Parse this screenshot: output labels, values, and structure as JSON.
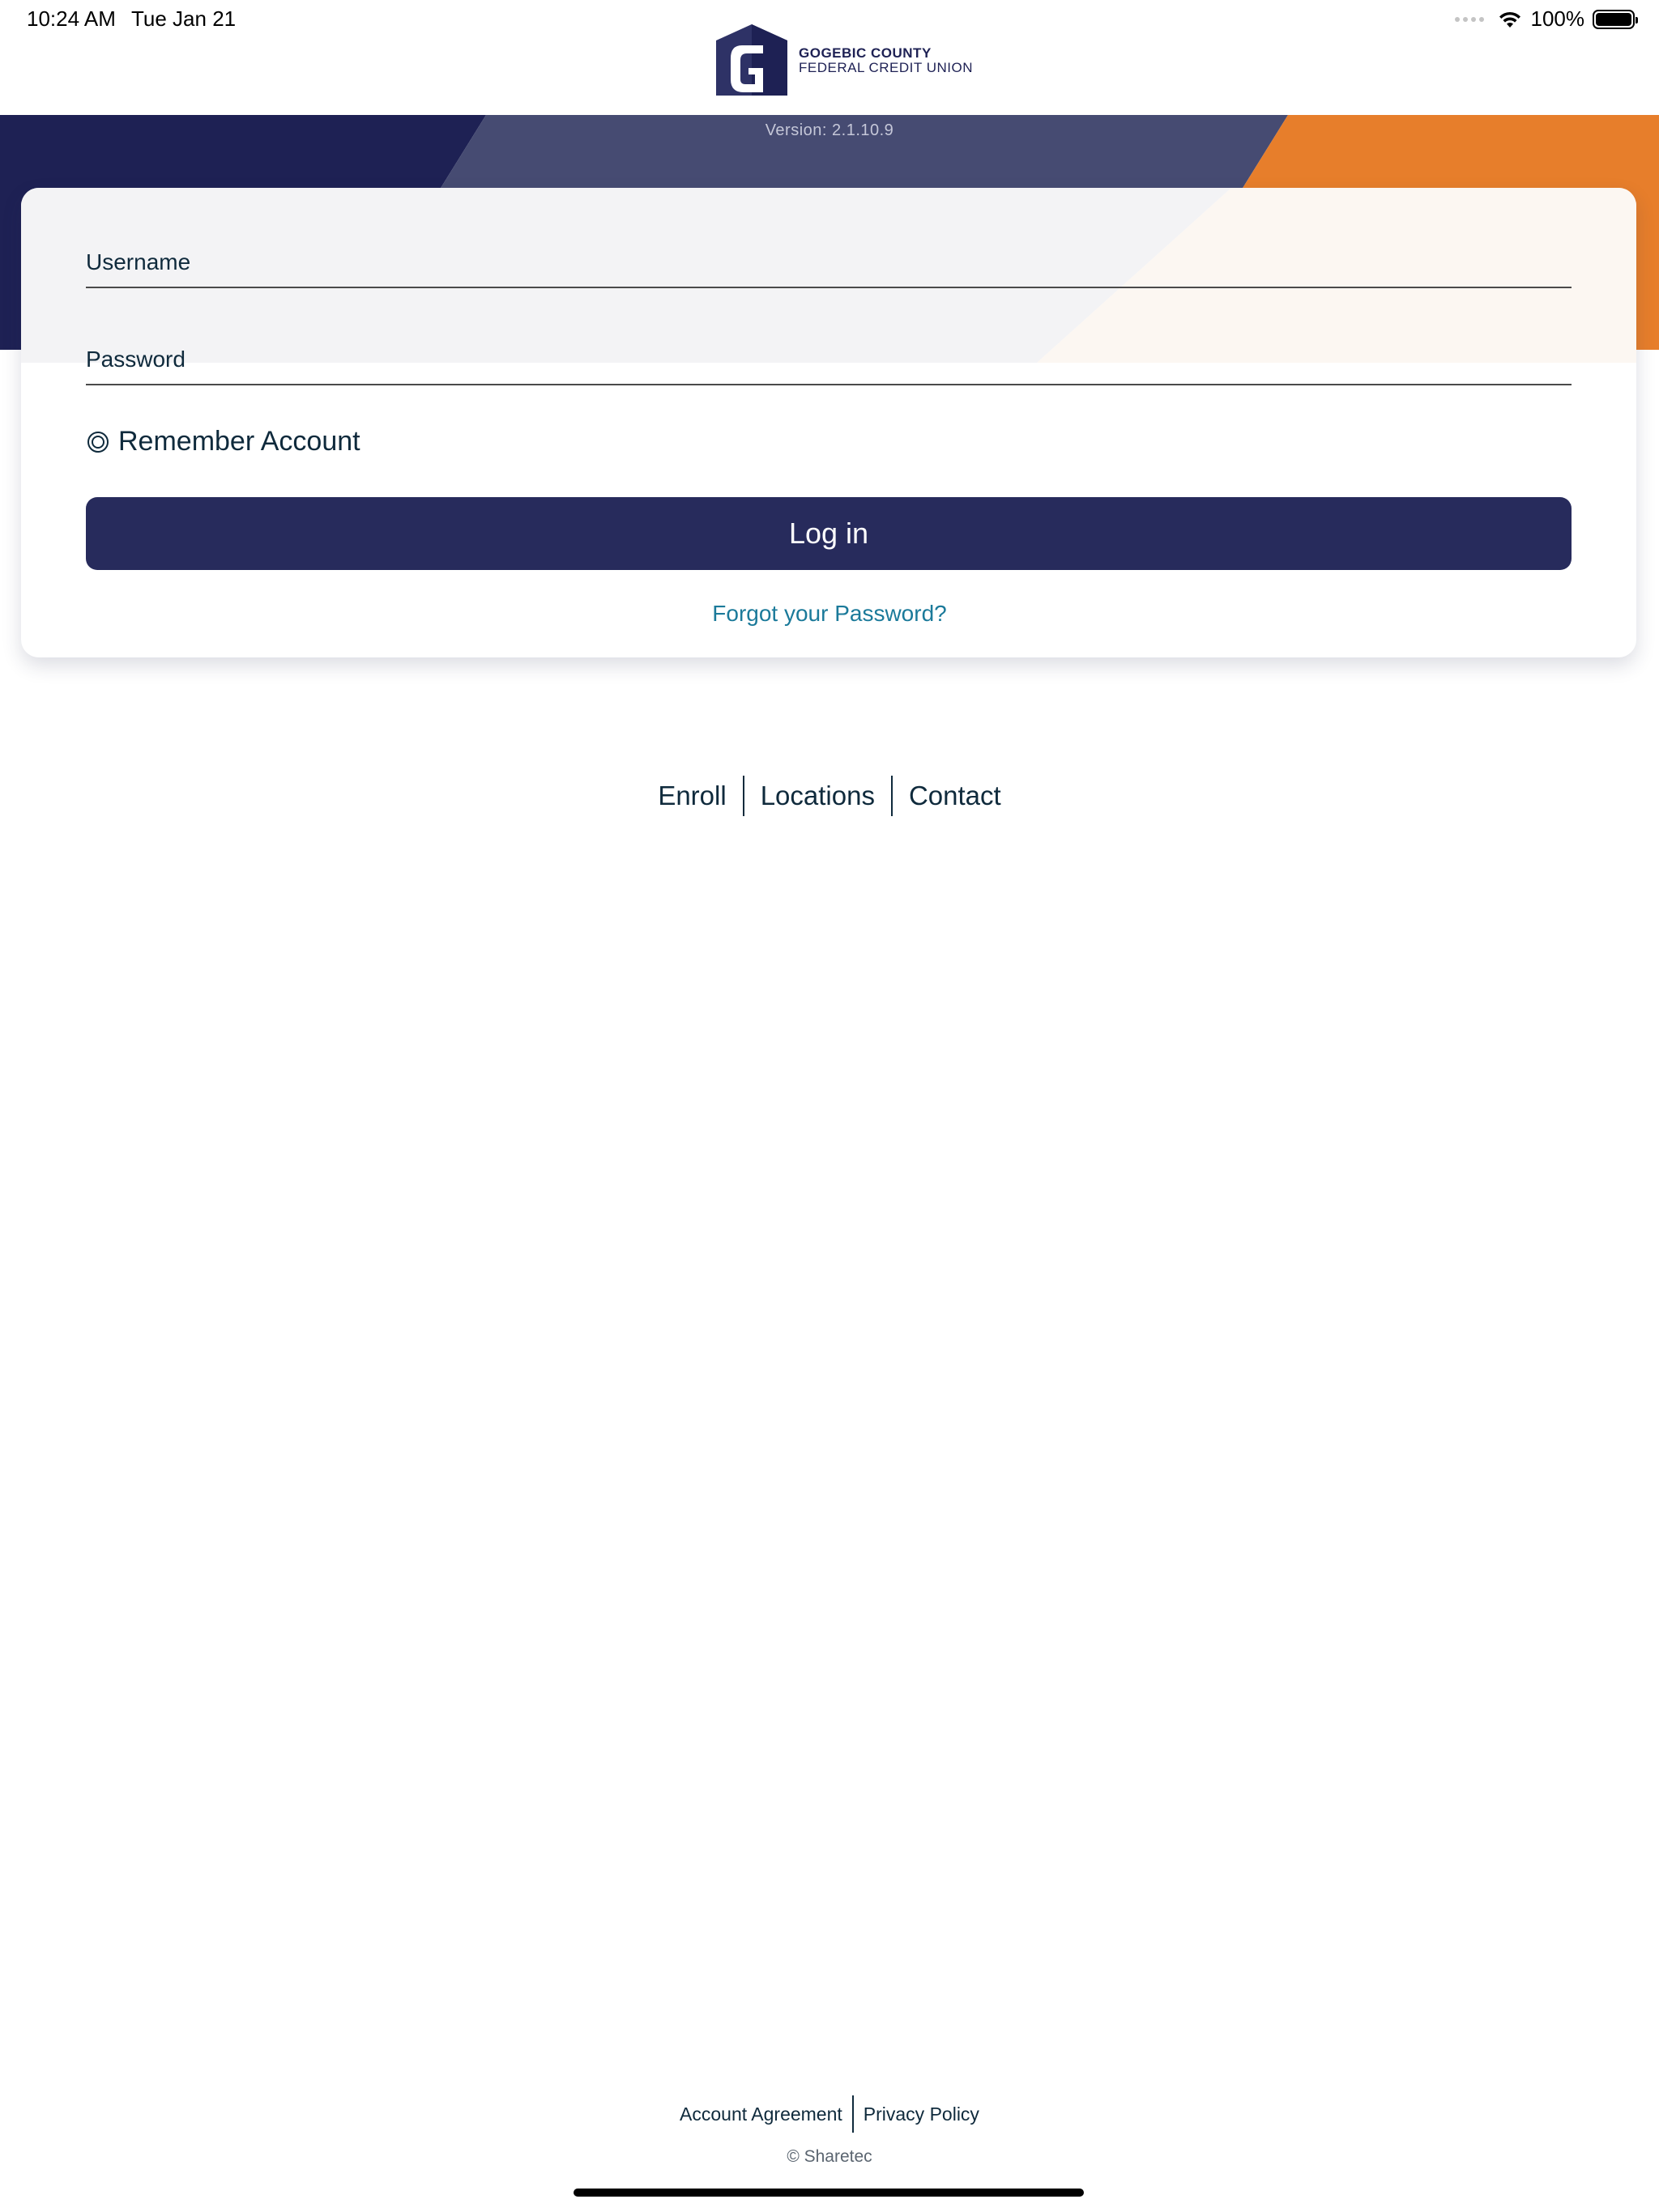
{
  "status_bar": {
    "time": "10:24 AM",
    "date": "Tue Jan 21",
    "battery_percent": "100%",
    "battery_level": 1.0,
    "icons": [
      "signal-dots-icon",
      "wifi-icon",
      "battery-icon"
    ]
  },
  "header": {
    "logo_line1": "GOGEBIC COUNTY",
    "logo_line2": "FEDERAL CREDIT UNION",
    "version": "Version: 2.1.10.9"
  },
  "colors": {
    "navy": "#1e2154",
    "slate": "#464b72",
    "orange": "#e77e2b",
    "button": "#272b5c",
    "link": "#1b7a9a",
    "text": "#0f2a3c"
  },
  "login": {
    "username_label": "Username",
    "username_value": "",
    "password_label": "Password",
    "password_value": "",
    "remember_label": "Remember Account",
    "remember_checked": false,
    "login_button": "Log in",
    "forgot_link": "Forgot your Password?"
  },
  "nav": {
    "enroll": "Enroll",
    "locations": "Locations",
    "contact": "Contact"
  },
  "footer": {
    "account_agreement": "Account Agreement",
    "privacy_policy": "Privacy Policy",
    "copyright": "© Sharetec"
  }
}
